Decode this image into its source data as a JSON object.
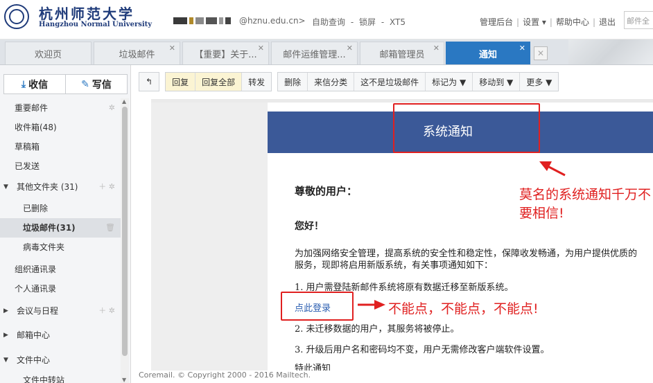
{
  "header": {
    "uni_cn": "杭州师范大学",
    "uni_en": "Hangzhou Normal University",
    "user_email": "@hznu.edu.cn>",
    "links": [
      "自助查询",
      "-",
      "锁屏",
      "-",
      "XT5"
    ],
    "nav": [
      "管理后台",
      "设置 ▾",
      "帮助中心",
      "退出"
    ],
    "mail_search_placeholder": "邮件全"
  },
  "tabs": [
    {
      "label": "欢迎页"
    },
    {
      "label": "垃圾邮件"
    },
    {
      "label": "【重要】关于..."
    },
    {
      "label": "邮件运维管理..."
    },
    {
      "label": "邮箱管理员"
    },
    {
      "label": "通知"
    }
  ],
  "sidebar": {
    "receive_label": "收信",
    "compose_label": "写信",
    "items": [
      {
        "label": "重要邮件"
      },
      {
        "label": "收件箱(48)"
      },
      {
        "label": "草稿箱"
      },
      {
        "label": "已发送"
      },
      {
        "label": "其他文件夹 (31)"
      },
      {
        "label": "已删除"
      },
      {
        "label": "垃圾邮件(31)"
      },
      {
        "label": "病毒文件夹"
      },
      {
        "label": "组织通讯录"
      },
      {
        "label": "个人通讯录"
      },
      {
        "label": "会议与日程"
      },
      {
        "label": "邮箱中心"
      },
      {
        "label": "文件中心"
      },
      {
        "label": "文件中转站"
      }
    ]
  },
  "toolbar": {
    "back": "↰",
    "reply": "回复",
    "reply_all": "回复全部",
    "forward": "转发",
    "delete": "删除",
    "classify": "来信分类",
    "not_spam": "这不是垃圾邮件",
    "mark_as": "标记为 ▼",
    "move_to": "移动到 ▼",
    "more": "更多 ▼"
  },
  "message": {
    "notice_title": "系统通知",
    "greeting": "尊敬的用户：",
    "hello": "您好！",
    "intro": "为加强网络安全管理，提高系统的安全性和稳定性，保障收发畅通，为用户提供优质的服务，现即将启用新版系统，有关事项通知如下：",
    "item1": "1. 用户需登陆新邮件系统将原有数据迁移至新版系统。",
    "login_link": "点此登录",
    "item2": "2. 未迁移数据的用户，其服务将被停止。",
    "item3": "3. 升级后用户名和密码均不变，用户无需修改客户端软件设置。",
    "item4": "特此通知"
  },
  "annotations": {
    "warning1": "莫名的系统通知千万不要相信!",
    "warning2": "不能点，不能点，不能点!",
    "color": "#e02020"
  },
  "footer": {
    "copyright": "Coremail. © Copyright 2000 - 2016 Mailtech."
  }
}
